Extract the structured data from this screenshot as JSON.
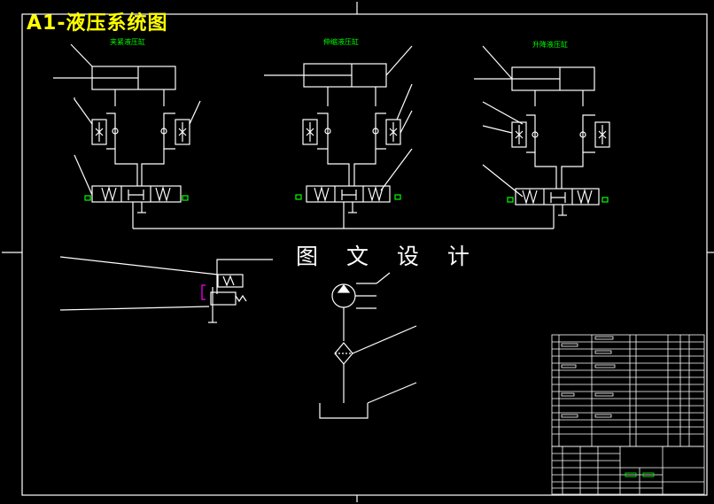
{
  "drawing": {
    "title": "A1-液压系统图",
    "watermark": "图 文 设 计",
    "cylinders": [
      {
        "label": "夹紧液压缸"
      },
      {
        "label": "伸缩液压缸"
      },
      {
        "label": "升降液压缸"
      }
    ],
    "colors": {
      "background": "#000000",
      "lines": "#ffffff",
      "title": "#ffff00",
      "labels": "#00ff00",
      "accent": "#ff00ff"
    }
  }
}
